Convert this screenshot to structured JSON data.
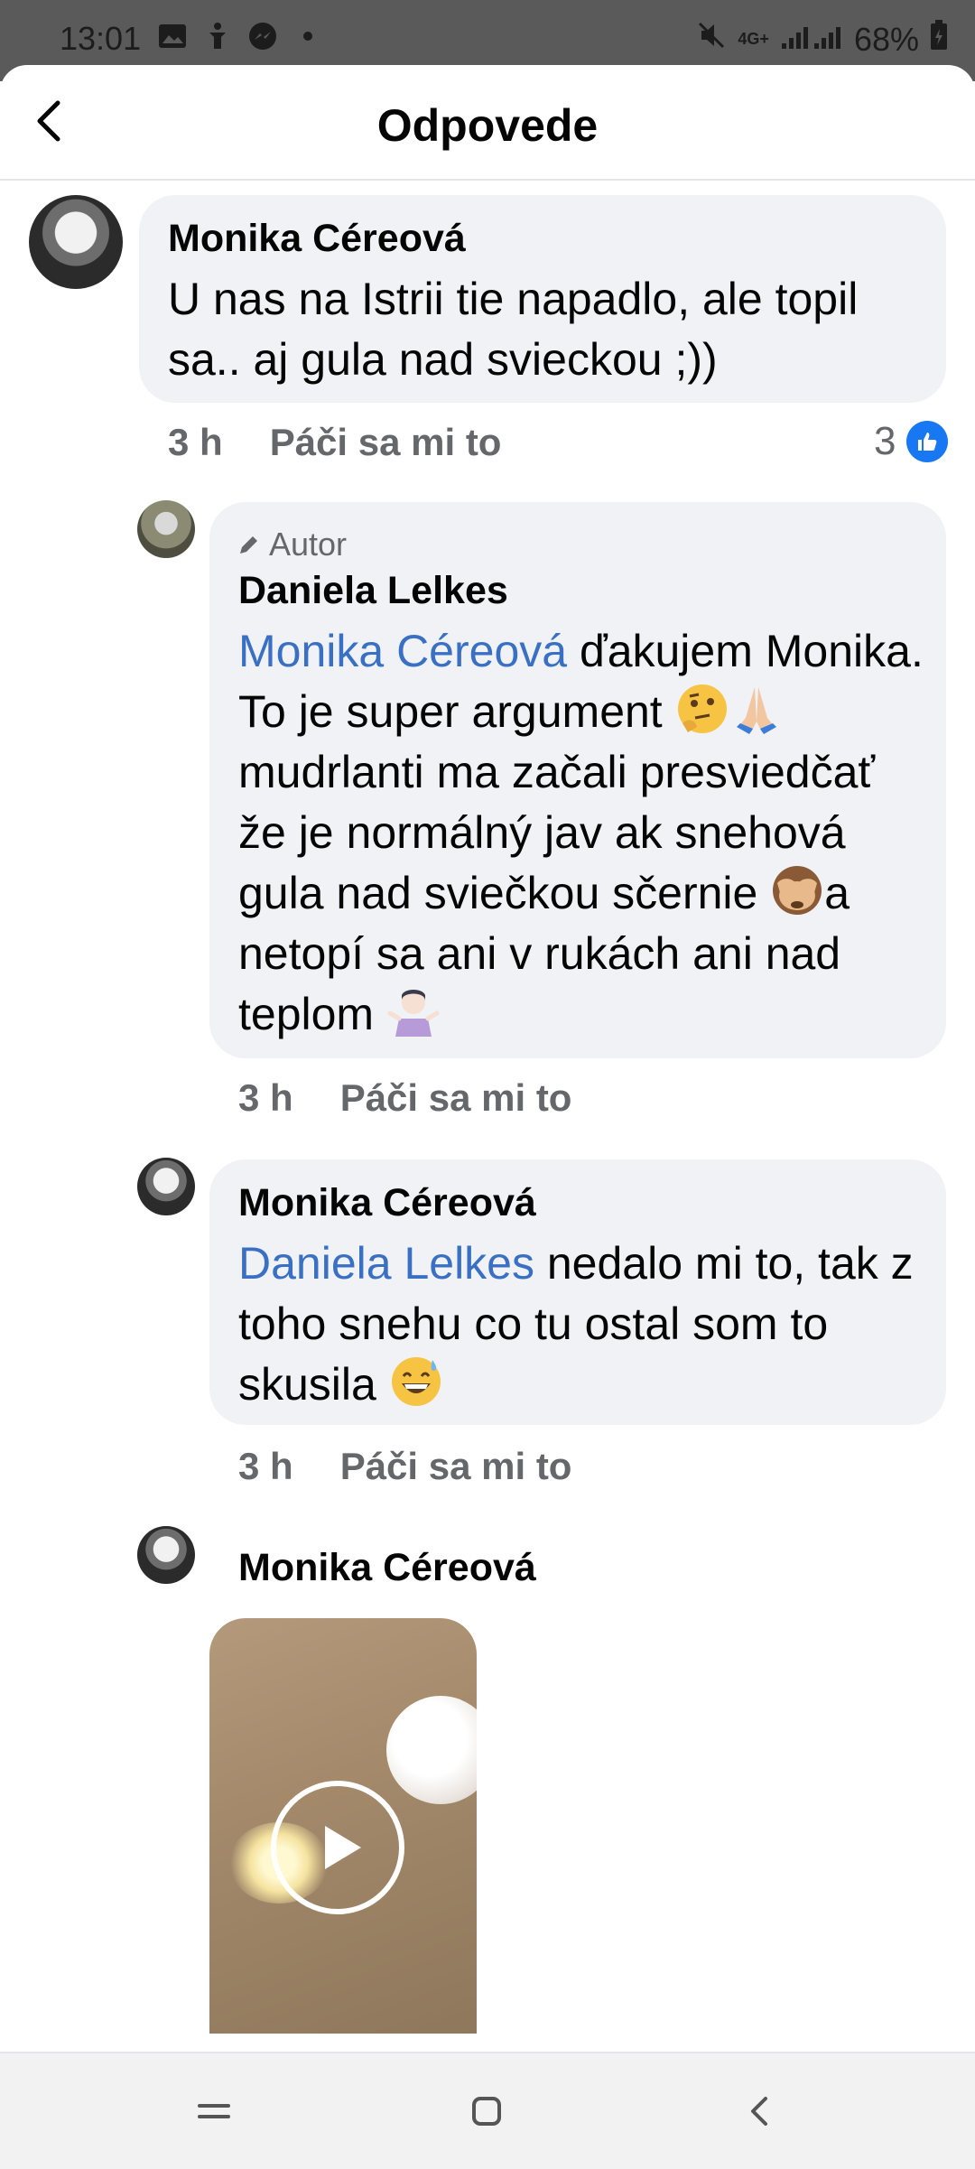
{
  "status_bar": {
    "time": "13:01",
    "network": "4G+",
    "battery": "68%"
  },
  "header": {
    "title": "Odpovede"
  },
  "comments": [
    {
      "author": "Monika Céreová",
      "text": "U nas na Istrii tie napadlo, ale topil sa.. aj gula nad svieckou ;))",
      "time": "3 h",
      "like_label": "Páči sa mi to",
      "likes": "3"
    },
    {
      "tag": "Autor",
      "author": "Daniela Lelkes",
      "mention": "Monika Céreová",
      "text_1": " ďakujem Monika. To je super argument ",
      "emoji_1": "thinking-face",
      "emoji_2": "folded-hands",
      "text_2": "mudrlanti ma začali presviedčať že je normálný jav ak snehová gula nad sviečkou sčernie ",
      "emoji_3": "see-no-evil-monkey",
      "text_3": "a netopí sa ani v rukách ani nad teplom ",
      "emoji_4": "person-shrugging",
      "time": "3 h",
      "like_label": "Páči sa mi to"
    },
    {
      "author": "Monika Céreová",
      "mention": "Daniela Lelkes",
      "text_1": " nedalo mi to, tak z toho snehu co tu ostal som to skusila ",
      "emoji_1": "grinning-face-with-sweat",
      "time": "3 h",
      "like_label": "Páči sa mi to"
    },
    {
      "author": "Monika Céreová",
      "attachment": "video"
    }
  ],
  "colors": {
    "mention": "#3a70c4",
    "bubble": "#f0f2f5",
    "like": "#1877f2",
    "meta": "#65676b"
  }
}
